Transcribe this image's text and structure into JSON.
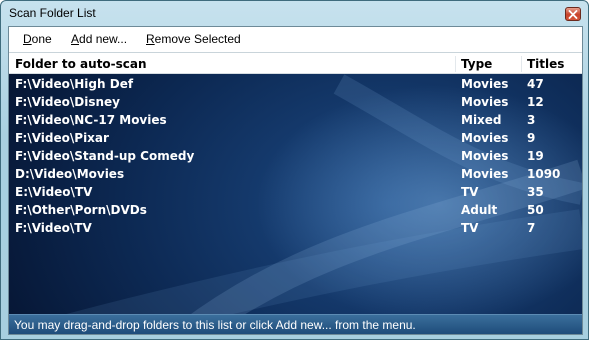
{
  "window": {
    "title": "Scan Folder List"
  },
  "menu": {
    "done": {
      "key": "D",
      "rest": "one"
    },
    "add": {
      "key": "A",
      "rest": "dd new..."
    },
    "remove": {
      "key": "R",
      "rest": "emove Selected"
    }
  },
  "columns": {
    "folder": "Folder to auto-scan",
    "type": "Type",
    "titles": "Titles"
  },
  "rows": [
    {
      "folder": "F:\\Video\\High Def",
      "type": "Movies",
      "titles": "47"
    },
    {
      "folder": "F:\\Video\\Disney",
      "type": "Movies",
      "titles": "12"
    },
    {
      "folder": "F:\\Video\\NC-17 Movies",
      "type": "Mixed",
      "titles": "3"
    },
    {
      "folder": "F:\\Video\\Pixar",
      "type": "Movies",
      "titles": "9"
    },
    {
      "folder": "F:\\Video\\Stand-up Comedy",
      "type": "Movies",
      "titles": "19"
    },
    {
      "folder": "D:\\Video\\Movies",
      "type": "Movies",
      "titles": "1090"
    },
    {
      "folder": "E:\\Video\\TV",
      "type": "TV",
      "titles": "35"
    },
    {
      "folder": "F:\\Other\\Porn\\DVDs",
      "type": "Adult",
      "titles": "50"
    },
    {
      "folder": "F:\\Video\\TV",
      "type": "TV",
      "titles": "7"
    }
  ],
  "status": {
    "text": "You may drag-and-drop folders to this list or click Add new...  from the menu."
  },
  "icons": {
    "close": "close-icon"
  },
  "colors": {
    "list_bg": "#0d2a55",
    "status_bg": "#2a5a88",
    "row_text": "#ffffff",
    "close_red": "#c8422a"
  }
}
